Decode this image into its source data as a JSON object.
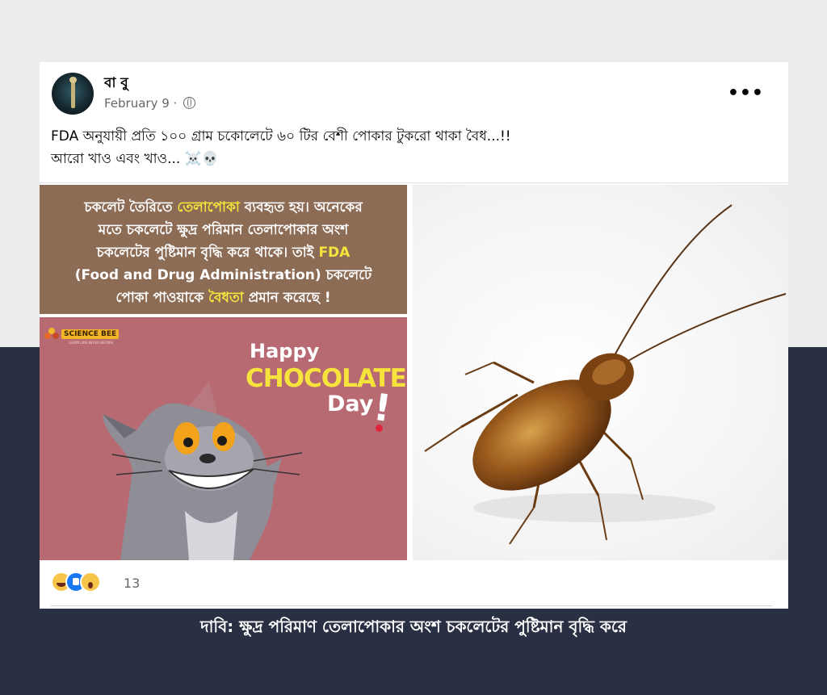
{
  "post": {
    "author": "বা বু",
    "date": "February 9 ·",
    "menu_icon": "more-options-icon",
    "text_line1": "FDA অনুযায়ী প্রতি ১০০ গ্রাম চকোলেটে ৬০ টির বেশী পোকার টুকরো থাকা বৈধ...!!",
    "text_line2": "আরো খাও এবং খাও... ☠️💀"
  },
  "image_left": {
    "bengali_line1_a": "চকলেট তৈরিতে ",
    "bengali_line1_hl": "তেলাপোকা",
    "bengali_line1_b": " ব্যবহৃত হয়। অনেকের",
    "bengali_line2": "মতে চকলেটে ক্ষুদ্র পরিমান তেলাপোকার অংশ",
    "bengali_line3_a": "চকলেটের পুষ্টিমান বৃদ্ধি করে থাকে। তাই ",
    "bengali_line3_hl": "FDA",
    "bengali_line4": "(Food and Drug Administration) চকলেটে",
    "bengali_line5_a": "পোকা পাওয়াকে ",
    "bengali_line5_hl": "বৈধতা",
    "bengali_line5_b": " প্রমান করেছে !",
    "logo_text": "SCIENCE BEE",
    "logo_sub": "LEARN LIKE NEVER BEFORE",
    "happy": "Happy",
    "chocolate": "CHOCOLATE",
    "day": "Day",
    "bang": "!"
  },
  "reactions": {
    "icons": [
      "haha-icon",
      "like-icon",
      "wow-icon"
    ],
    "count": "13"
  },
  "caption": "দাবি: ক্ষুদ্র পরিমাণ তেলাপোকার অংশ চকলেটের পুষ্টিমান বৃদ্ধি করে",
  "colors": {
    "page_top": "#eceded",
    "page_bottom": "#2a3043",
    "brown_box": "#8d6c56",
    "pink_box": "#b86a73",
    "highlight": "#f6e33b"
  }
}
